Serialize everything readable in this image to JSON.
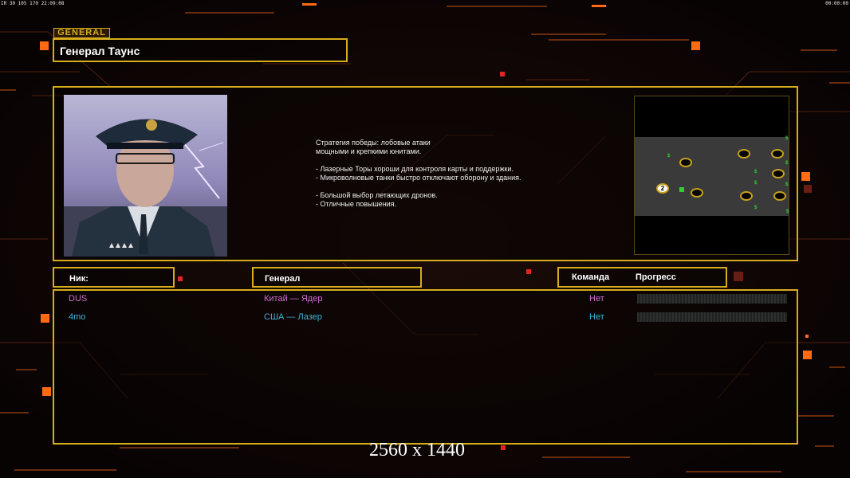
{
  "hud": {
    "top_left": "IR 30 105 170 22:09:08",
    "top_right": "00:00:00"
  },
  "general": {
    "tag": "GENERAL",
    "name": "Генерал Таунс",
    "description": [
      "Стратегия победы: лобовые атаки",
      "мощными и крепкими юнитами.",
      "",
      "- Лазерные Торы хороши для контроля карты и поддержки.",
      "- Микроволновые танки быстро отключают оборону и здания.",
      "",
      "- Большой выбор летающих дронов.",
      "- Отличные повышения."
    ]
  },
  "map": {
    "marker": "2",
    "money_symbol": "$"
  },
  "table": {
    "headers": {
      "nick": "Ник:",
      "general": "Генерал",
      "team": "Команда",
      "progress": "Прогресс"
    },
    "rows": [
      {
        "nick": "DUS",
        "general": "Китай — Ядер",
        "team": "Нет",
        "progress": 0,
        "color": "#cf6fd0"
      },
      {
        "nick": "4mo",
        "general": "США — Лазер",
        "team": "Нет",
        "progress": 0,
        "color": "#3cb3d8"
      }
    ]
  },
  "watermark": "2560 x 1440",
  "colors": {
    "frame": "#d6ad1a",
    "accent": "#ff6a12"
  }
}
